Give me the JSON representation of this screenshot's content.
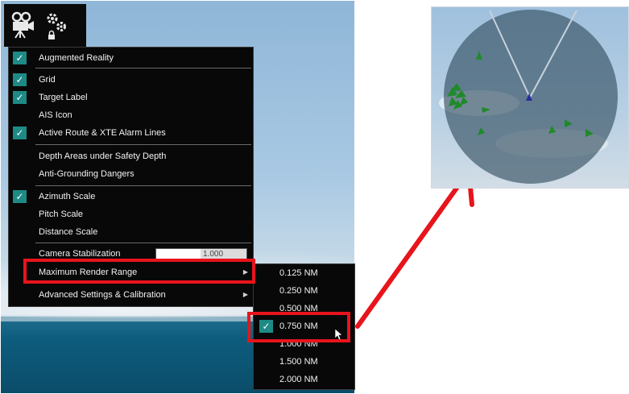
{
  "menu": {
    "items": [
      {
        "label": "Augmented Reality",
        "checked": true
      },
      {
        "label": "Grid",
        "checked": true
      },
      {
        "label": "Target Label",
        "checked": true
      },
      {
        "label": "AIS Icon",
        "checked": false
      },
      {
        "label": "Active Route & XTE Alarm Lines",
        "checked": true
      },
      {
        "label": "Depth Areas under Safety Depth",
        "checked": false
      },
      {
        "label": "Anti-Grounding Dangers",
        "checked": false
      },
      {
        "label": "Azimuth Scale",
        "checked": true
      },
      {
        "label": "Pitch Scale",
        "checked": false
      },
      {
        "label": "Distance Scale",
        "checked": false
      },
      {
        "label": "Camera Stabilization",
        "checked": false
      },
      {
        "label": "Maximum Render Range",
        "checked": false,
        "submenu": true
      },
      {
        "label": "Advanced Settings & Calibration",
        "checked": false,
        "submenu": true
      }
    ],
    "camera_stabilization_value": "1.000"
  },
  "submenu": {
    "items": [
      "0.125 NM",
      "0.250 NM",
      "0.500 NM",
      "0.750 NM",
      "1.000 NM",
      "1.500 NM",
      "2.000 NM"
    ],
    "selected": "0.750 NM"
  },
  "toolbar": {
    "camera_icon": "video-camera-icon",
    "settings_icon": "gears-lock-icon"
  },
  "colors": {
    "highlight": "#e8141c",
    "check": "#1e8a86",
    "target": "#1f8a2a",
    "own_ship": "#2a2f9a"
  }
}
